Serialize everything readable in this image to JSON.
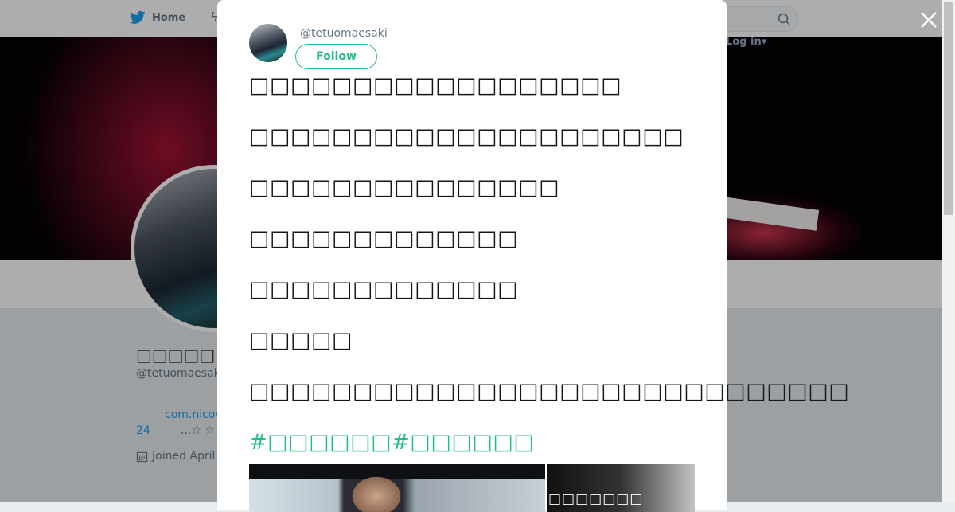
{
  "background": {
    "nav_home_label": "Home",
    "login_label": "Log in",
    "profile": {
      "name": "□□□□□",
      "handle": "@tetuomaesak",
      "link": "com.nicov",
      "stat_number": "24",
      "stat_text": "...☆ ☆",
      "joined": "Joined April"
    }
  },
  "modal": {
    "handle": "@tetuomaesaki",
    "follow_label": "Follow",
    "tweet_lines": [
      "□□□□□□□□□□□□□□□□□□",
      "□□□□□□□□□□□□□□□□□□□□□",
      "□□□□□□□□□□□□□□□",
      "□□□□□□□□□□□□□",
      "□□□□□□□□□□□□□",
      "□□□□□",
      "□□□□□□□□□□□□□□□□□□□□□□□□□□□□□"
    ],
    "hashtags": "#□□□□□□#□□□□□□",
    "media_caption": "□□□□□□□"
  },
  "colors": {
    "accent": "#21bf86",
    "link_blue": "#1da1f2",
    "twitter_blue": "#1da1f2"
  },
  "icons": {
    "logo": "twitter-bird-icon",
    "search": "search-icon",
    "close": "close-icon",
    "calendar": "calendar-icon"
  }
}
